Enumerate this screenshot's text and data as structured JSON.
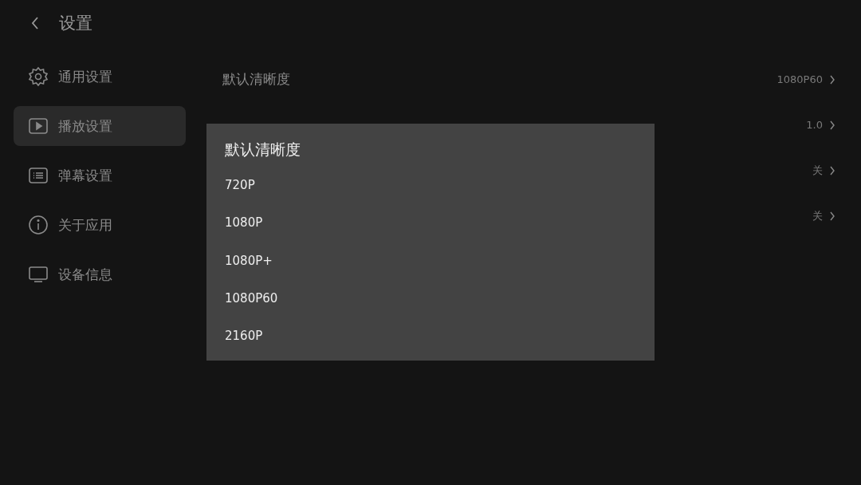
{
  "header": {
    "title": "设置"
  },
  "sidebar": {
    "items": [
      {
        "kind": "gear",
        "label": "通用设置",
        "selected": false
      },
      {
        "kind": "play",
        "label": "播放设置",
        "selected": true
      },
      {
        "kind": "list",
        "label": "弹幕设置",
        "selected": false
      },
      {
        "kind": "info",
        "label": "关于应用",
        "selected": false
      },
      {
        "kind": "tv",
        "label": "设备信息",
        "selected": false
      }
    ]
  },
  "settings": [
    {
      "label": "默认清晰度",
      "value": "1080P60"
    },
    {
      "value": "1.0"
    },
    {
      "value": "关"
    },
    {
      "value": "关"
    }
  ],
  "dialog": {
    "title": "默认清晰度",
    "options": [
      "720P",
      "1080P",
      "1080P+",
      "1080P60",
      "2160P"
    ]
  }
}
